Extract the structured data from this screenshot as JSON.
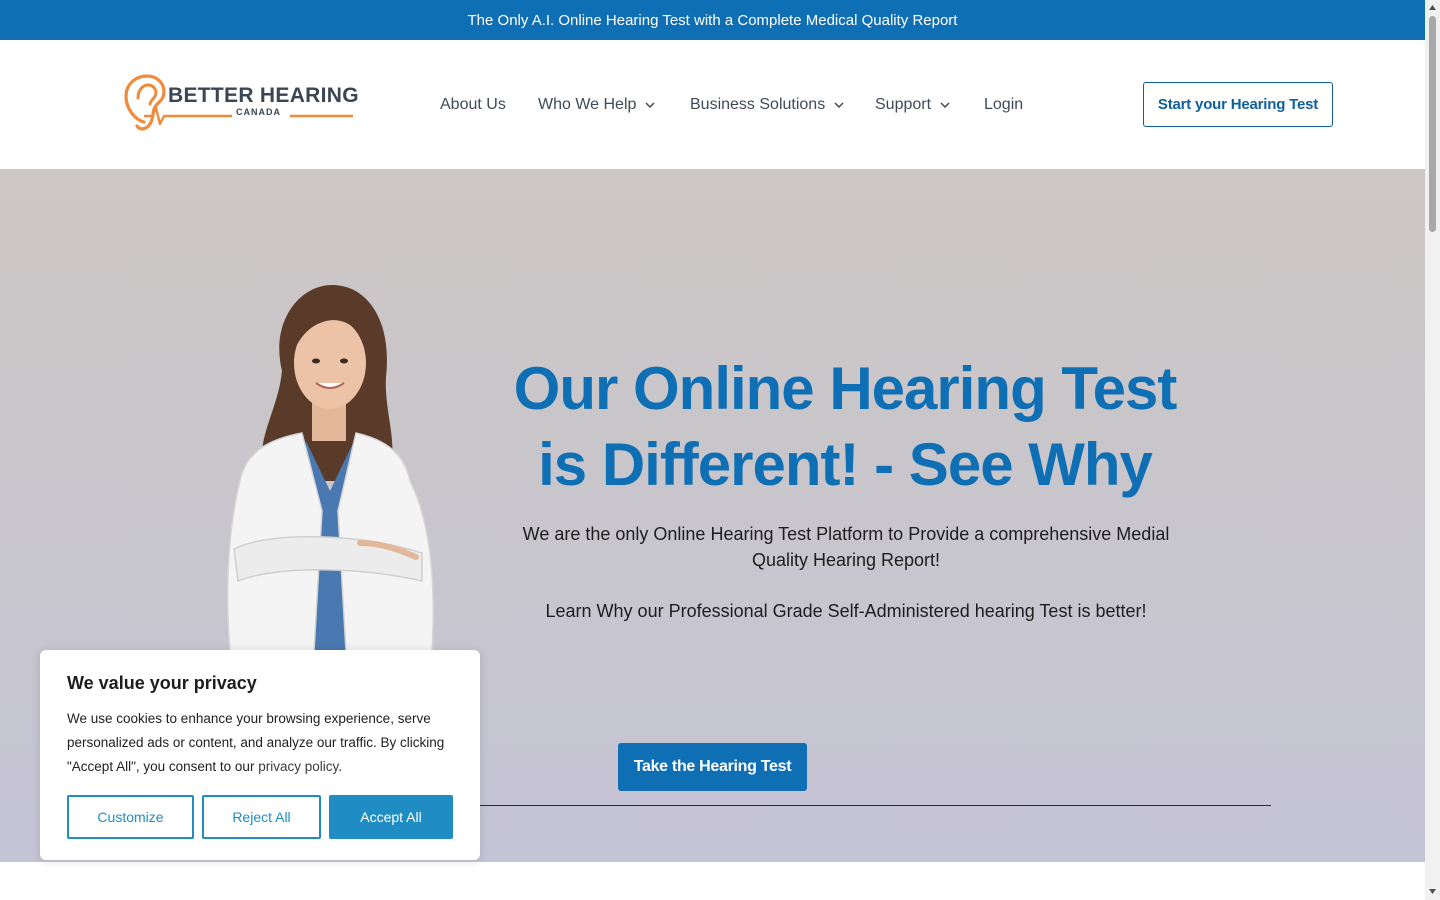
{
  "topbar": {
    "text": "The Only A.I. Online Hearing Test with a Complete Medical Quality Report"
  },
  "header": {
    "logo": {
      "brand": "BETTER HEARING",
      "sub": "CANADA"
    },
    "nav": [
      {
        "label": "About Us",
        "has_dropdown": false
      },
      {
        "label": "Who We Help",
        "has_dropdown": true
      },
      {
        "label": "Business Solutions",
        "has_dropdown": true
      },
      {
        "label": "Support",
        "has_dropdown": true
      },
      {
        "label": "Login",
        "has_dropdown": false
      }
    ],
    "cta": "Start your Hearing Test"
  },
  "hero": {
    "title_line1": "Our Online Hearing Test",
    "title_line2": "is Different! - See Why",
    "subtitle": "We are the only Online Hearing Test Platform to Provide a comprehensive Medial Quality Hearing Report!",
    "subtitle2": "Learn Why our Professional Grade Self-Administered hearing Test is better!",
    "button": "Take the Hearing Test"
  },
  "cookie": {
    "title": "We value your privacy",
    "text_before_link": "We use cookies to enhance your browsing experience, serve personalized ads or content, and analyze our traffic. By clicking \"Accept All\", you consent to our ",
    "link_text": "privacy policy",
    "text_after_link": ".",
    "buttons": {
      "customize": "Customize",
      "reject": "Reject All",
      "accept": "Accept All"
    }
  },
  "colors": {
    "brand_blue": "#0f6fb5",
    "accent_orange": "#f08a3c",
    "cookie_blue": "#1f8dc4"
  }
}
